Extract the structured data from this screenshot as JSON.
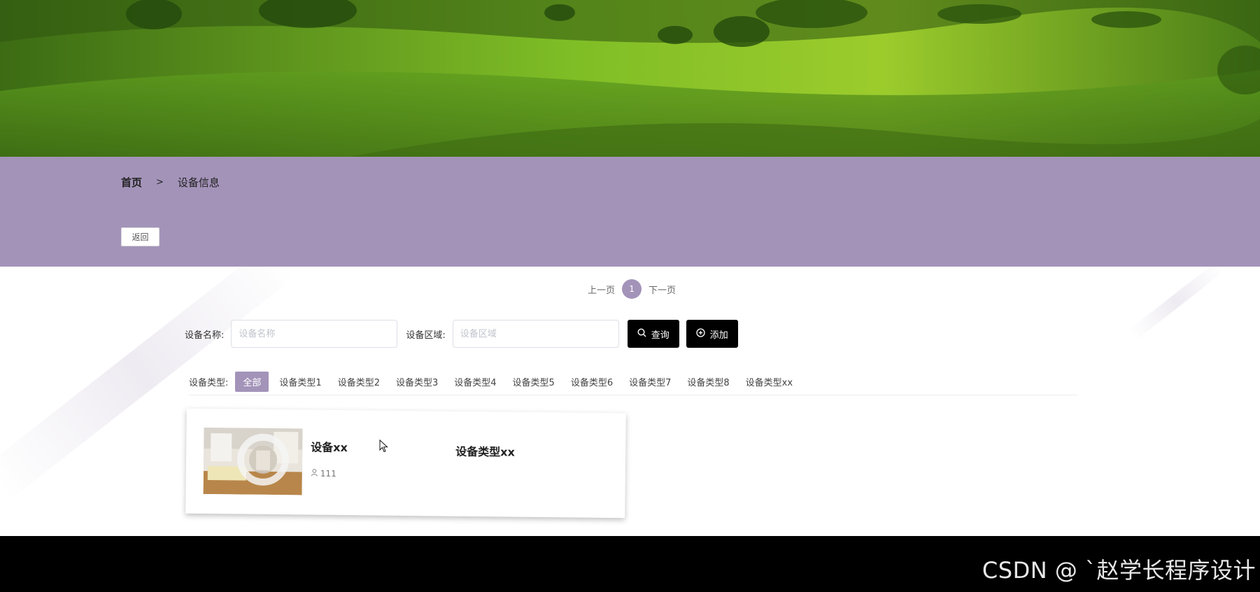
{
  "breadcrumb": {
    "home": "首页",
    "separator": ">",
    "current": "设备信息"
  },
  "back_button": "返回",
  "pagination": {
    "prev": "上一页",
    "current_page": "1",
    "next": "下一页"
  },
  "search": {
    "name_label": "设备名称:",
    "name_placeholder": "设备名称",
    "area_label": "设备区域:",
    "area_placeholder": "设备区域",
    "query_button": "查询",
    "add_button": "添加"
  },
  "type_filter": {
    "label": "设备类型:",
    "items": [
      "全部",
      "设备类型1",
      "设备类型2",
      "设备类型3",
      "设备类型4",
      "设备类型5",
      "设备类型6",
      "设备类型7",
      "设备类型8",
      "设备类型xx"
    ]
  },
  "device_card": {
    "name": "设备xx",
    "count": "111",
    "type": "设备类型xx"
  },
  "watermark": "CSDN @ ˋ赵学长程序设计",
  "colors": {
    "accent": "#a393b9",
    "button_dark": "#000000"
  },
  "icons": {
    "search": "search-icon",
    "add": "plus-circle-icon",
    "user": "user-icon"
  }
}
